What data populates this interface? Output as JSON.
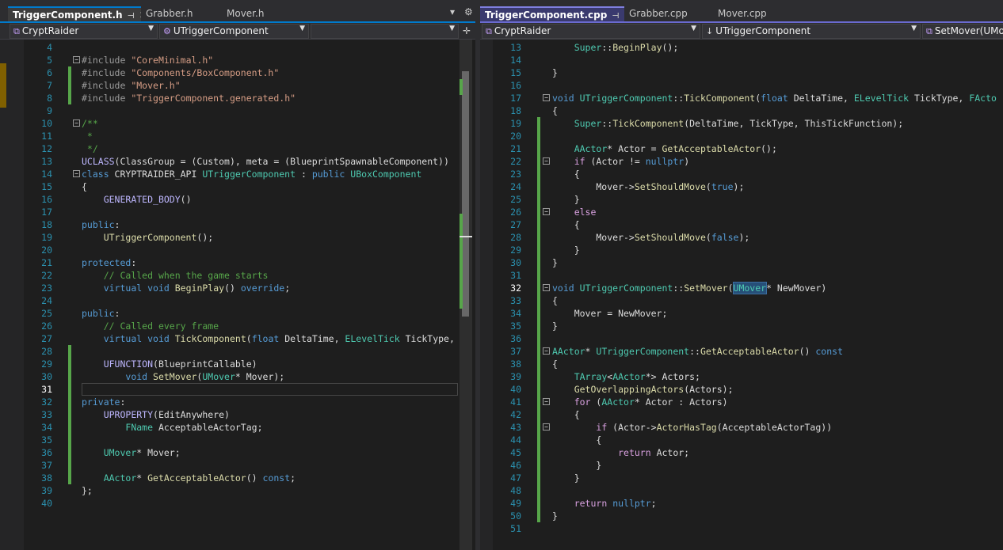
{
  "left": {
    "tabs": [
      {
        "label": "TriggerComponent.h",
        "active": true
      },
      {
        "label": "Grabber.h",
        "active": false
      },
      {
        "label": "Mover.h",
        "active": false
      }
    ],
    "project_combo": "CryptRaider",
    "scope_combo": "UTriggerComponent",
    "member_combo": "",
    "lines": [
      {
        "n": "4",
        "html": ""
      },
      {
        "n": "5",
        "html": "<span class='pp'>#include</span> <span class='st'>\"CoreMinimal.h\"</span>"
      },
      {
        "n": "6",
        "html": "<span class='pp'>#include</span> <span class='st'>\"Components/BoxComponent.h\"</span>"
      },
      {
        "n": "7",
        "html": "<span class='pp'>#include</span> <span class='st'>\"Mover.h\"</span>"
      },
      {
        "n": "8",
        "html": "<span class='pp'>#include</span> <span class='st'>\"TriggerComponent.generated.h\"</span>"
      },
      {
        "n": "9",
        "html": ""
      },
      {
        "n": "10",
        "html": "<span class='cm'>/**</span>"
      },
      {
        "n": "11",
        "html": "<span class='cm'> *</span>"
      },
      {
        "n": "12",
        "html": "<span class='cm'> */</span>"
      },
      {
        "n": "13",
        "html": "<span class='mc'>UCLASS</span>(ClassGroup = (Custom), meta = (BlueprintSpawnableComponent))"
      },
      {
        "n": "14",
        "html": "<span class='kw'>class</span> CRYPTRAIDER_API <span class='ty'>UTriggerComponent</span> : <span class='kw'>public</span> <span class='ty'>UBoxComponent</span>"
      },
      {
        "n": "15",
        "html": "{"
      },
      {
        "n": "16",
        "html": "    <span class='mc'>GENERATED_BODY</span>()"
      },
      {
        "n": "17",
        "html": ""
      },
      {
        "n": "18",
        "html": "<span class='kw'>public</span>:"
      },
      {
        "n": "19",
        "html": "    <span class='fn'>UTriggerComponent</span>();"
      },
      {
        "n": "20",
        "html": ""
      },
      {
        "n": "21",
        "html": "<span class='kw'>protected</span>:"
      },
      {
        "n": "22",
        "html": "    <span class='cm'>// Called when the game starts</span>"
      },
      {
        "n": "23",
        "html": "    <span class='kw'>virtual</span> <span class='kw'>void</span> <span class='fn'>BeginPlay</span>() <span class='kw'>override</span>;"
      },
      {
        "n": "24",
        "html": ""
      },
      {
        "n": "25",
        "html": "<span class='kw'>public</span>:"
      },
      {
        "n": "26",
        "html": "    <span class='cm'>// Called every frame</span>"
      },
      {
        "n": "27",
        "html": "    <span class='kw'>virtual</span> <span class='kw'>void</span> <span class='fn'>TickComponent</span>(<span class='kw'>float</span> DeltaTime, <span class='ty'>ELevelTick</span> TickType,"
      },
      {
        "n": "28",
        "html": ""
      },
      {
        "n": "29",
        "html": "    <span class='mc'>UFUNCTION</span>(BlueprintCallable)"
      },
      {
        "n": "30",
        "html": "        <span class='kw'>void</span> <span class='fn'>SetMover</span>(<span class='ty'>UMover</span>* Mover);"
      },
      {
        "n": "31",
        "html": ""
      },
      {
        "n": "32",
        "html": "<span class='kw'>private</span>:"
      },
      {
        "n": "33",
        "html": "    <span class='mc'>UPROPERTY</span>(EditAnywhere)"
      },
      {
        "n": "34",
        "html": "        <span class='ty'>FName</span> AcceptableActorTag;"
      },
      {
        "n": "35",
        "html": ""
      },
      {
        "n": "36",
        "html": "    <span class='ty'>UMover</span>* Mover;"
      },
      {
        "n": "37",
        "html": ""
      },
      {
        "n": "38",
        "html": "    <span class='ty'>AActor</span>* <span class='fn'>GetAcceptableActor</span>() <span class='kw'>const</span>;"
      },
      {
        "n": "39",
        "html": "};"
      },
      {
        "n": "40",
        "html": ""
      }
    ]
  },
  "right": {
    "tabs": [
      {
        "label": "TriggerComponent.cpp",
        "active": true
      },
      {
        "label": "Grabber.cpp",
        "active": false
      },
      {
        "label": "Mover.cpp",
        "active": false
      }
    ],
    "project_combo": "CryptRaider",
    "scope_combo": "UTriggerComponent",
    "member_combo": "SetMover(UMo",
    "lines": [
      {
        "n": "13",
        "html": "    <span class='ty'>Super</span>::<span class='fn'>BeginPlay</span>();"
      },
      {
        "n": "14",
        "html": ""
      },
      {
        "n": "15",
        "html": "}"
      },
      {
        "n": "16",
        "html": ""
      },
      {
        "n": "17",
        "html": "<span class='kw'>void</span> <span class='ty'>UTriggerComponent</span>::<span class='fn'>TickComponent</span>(<span class='kw'>float</span> DeltaTime, <span class='ty'>ELevelTick</span> TickType, <span class='ty'>FActo</span>"
      },
      {
        "n": "18",
        "html": "{"
      },
      {
        "n": "19",
        "html": "    <span class='ty'>Super</span>::<span class='fn'>TickComponent</span>(DeltaTime, TickType, ThisTickFunction);"
      },
      {
        "n": "20",
        "html": ""
      },
      {
        "n": "21",
        "html": "    <span class='ty'>AActor</span>* Actor = <span class='fn'>GetAcceptableActor</span>();"
      },
      {
        "n": "22",
        "html": "    <span class='cl'>if</span> (Actor != <span class='kw'>nullptr</span>)"
      },
      {
        "n": "23",
        "html": "    {"
      },
      {
        "n": "24",
        "html": "        Mover-><span class='fn'>SetShouldMove</span>(<span class='kw'>true</span>);"
      },
      {
        "n": "25",
        "html": "    }"
      },
      {
        "n": "26",
        "html": "    <span class='cl'>else</span>"
      },
      {
        "n": "27",
        "html": "    {"
      },
      {
        "n": "28",
        "html": "        Mover-><span class='fn'>SetShouldMove</span>(<span class='kw'>false</span>);"
      },
      {
        "n": "29",
        "html": "    }"
      },
      {
        "n": "30",
        "html": "}"
      },
      {
        "n": "31",
        "html": ""
      },
      {
        "n": "32",
        "html": "<span class='kw'>void</span> <span class='ty'>UTriggerComponent</span>::<span class='fn'>SetMover</span>(<span class='ty highlight'>UMover</span>* NewMover)"
      },
      {
        "n": "33",
        "html": "{"
      },
      {
        "n": "34",
        "html": "    Mover = NewMover;"
      },
      {
        "n": "35",
        "html": "}"
      },
      {
        "n": "36",
        "html": ""
      },
      {
        "n": "37",
        "html": "<span class='ty'>AActor</span>* <span class='ty'>UTriggerComponent</span>::<span class='fn'>GetAcceptableActor</span>() <span class='kw'>const</span>"
      },
      {
        "n": "38",
        "html": "{"
      },
      {
        "n": "39",
        "html": "    <span class='ty'>TArray</span>&lt;<span class='ty'>AActor</span>*&gt; Actors;"
      },
      {
        "n": "40",
        "html": "    <span class='fn'>GetOverlappingActors</span>(Actors);"
      },
      {
        "n": "41",
        "html": "    <span class='cl'>for</span> (<span class='ty'>AActor</span>* Actor : Actors)"
      },
      {
        "n": "42",
        "html": "    {"
      },
      {
        "n": "43",
        "html": "        <span class='cl'>if</span> (Actor-><span class='fn'>ActorHasTag</span>(AcceptableActorTag))"
      },
      {
        "n": "44",
        "html": "        {"
      },
      {
        "n": "45",
        "html": "            <span class='cl'>return</span> Actor;"
      },
      {
        "n": "46",
        "html": "        }"
      },
      {
        "n": "47",
        "html": "    }"
      },
      {
        "n": "48",
        "html": ""
      },
      {
        "n": "49",
        "html": "    <span class='cl'>return</span> <span class='kw'>nullptr</span>;"
      },
      {
        "n": "50",
        "html": "}"
      },
      {
        "n": "51",
        "html": ""
      }
    ]
  }
}
